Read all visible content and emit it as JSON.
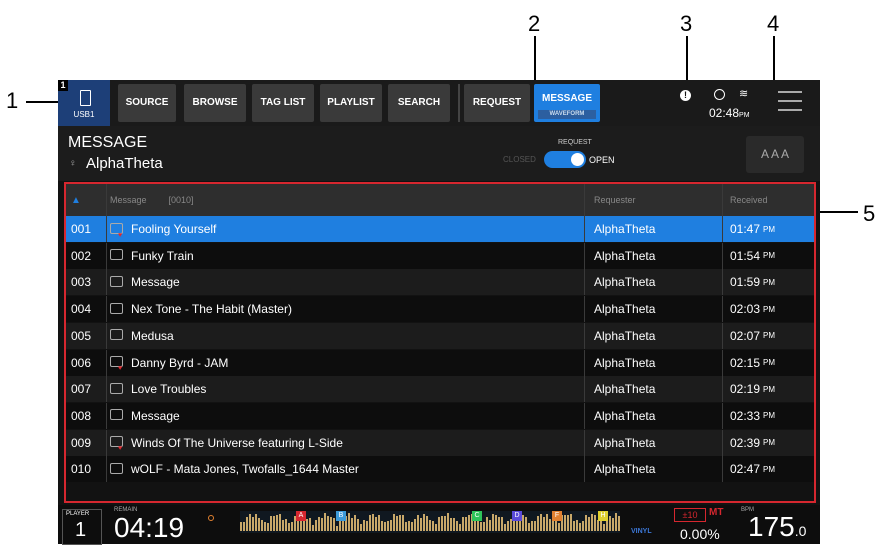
{
  "callouts": [
    "1",
    "2",
    "3",
    "4",
    "5"
  ],
  "topbar": {
    "usb_number": "1",
    "usb_label": "USB1",
    "tabs": [
      "SOURCE",
      "BROWSE",
      "TAG LIST",
      "PLAYLIST",
      "SEARCH",
      "REQUEST",
      "MESSAGE"
    ],
    "message_sub": "WAVEFORM",
    "time": "02:48",
    "time_suffix": "PM"
  },
  "header": {
    "title": "MESSAGE",
    "subtitle": "AlphaTheta",
    "toggle_top": "REQUEST",
    "toggle_off": "CLOSED",
    "toggle_on": "OPEN",
    "font_size_label": "A A A"
  },
  "list": {
    "columns": {
      "message": "Message",
      "count": "[0010]",
      "requester": "Requester",
      "received": "Received"
    },
    "rows": [
      {
        "num": "001",
        "message": "Fooling Yourself",
        "requester": "AlphaTheta",
        "time": "01:47",
        "pm": "PM",
        "heart": true
      },
      {
        "num": "002",
        "message": "Funky Train",
        "requester": "AlphaTheta",
        "time": "01:54",
        "pm": "PM",
        "heart": false
      },
      {
        "num": "003",
        "message": "Message",
        "requester": "AlphaTheta",
        "time": "01:59",
        "pm": "PM",
        "heart": false
      },
      {
        "num": "004",
        "message": "Nex Tone - The Habit (Master)",
        "requester": "AlphaTheta",
        "time": "02:03",
        "pm": "PM",
        "heart": false
      },
      {
        "num": "005",
        "message": "Medusa",
        "requester": "AlphaTheta",
        "time": "02:07",
        "pm": "PM",
        "heart": false
      },
      {
        "num": "006",
        "message": "Danny Byrd - JAM",
        "requester": "AlphaTheta",
        "time": "02:15",
        "pm": "PM",
        "heart": true
      },
      {
        "num": "007",
        "message": "Love Troubles",
        "requester": "AlphaTheta",
        "time": "02:19",
        "pm": "PM",
        "heart": false
      },
      {
        "num": "008",
        "message": "Message",
        "requester": "AlphaTheta",
        "time": "02:33",
        "pm": "PM",
        "heart": false
      },
      {
        "num": "009",
        "message": "Winds Of The Universe featuring L-Side",
        "requester": "AlphaTheta",
        "time": "02:39",
        "pm": "PM",
        "heart": true
      },
      {
        "num": "010",
        "message": "wOLF - Mata Jones, Twofalls_1644 Master",
        "requester": "AlphaTheta",
        "time": "02:47",
        "pm": "PM",
        "heart": false
      }
    ]
  },
  "bottom": {
    "player_label": "PLAYER",
    "player_number": "1",
    "remain_label": "REMAIN",
    "time_remaining": "04:19",
    "cue_letters": [
      "A",
      "B",
      "C",
      "D",
      "F",
      "H"
    ],
    "vinyl": "VINYL",
    "pitch_range": "±10",
    "mt": "MT",
    "pitch": "0.00%",
    "bpm_label": "BPM",
    "bpm_int": "175",
    "bpm_dec": ".0"
  },
  "colors": {
    "accent": "#1f7fe0",
    "selected_row": "#1f7fe0",
    "callout_border": "#d6272f"
  }
}
